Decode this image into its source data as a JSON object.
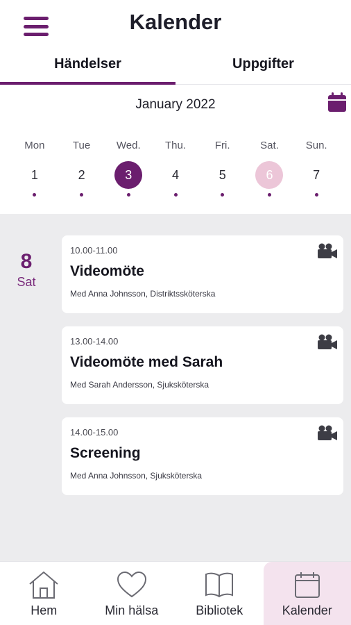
{
  "header": {
    "title": "Kalender",
    "menu_icon": "hamburger-icon"
  },
  "tabs": [
    {
      "label": "Händelser",
      "active": true
    },
    {
      "label": "Uppgifter",
      "active": false
    }
  ],
  "calendar": {
    "month_label": "January 2022",
    "picker_icon": "calendar-icon",
    "accent_color": "#6b1e6e",
    "today_color": "#ecc6d8",
    "days": [
      {
        "name": "Mon",
        "num": "1"
      },
      {
        "name": "Tue",
        "num": "2"
      },
      {
        "name": "Wed.",
        "num": "3",
        "selected": true
      },
      {
        "name": "Thu.",
        "num": "4"
      },
      {
        "name": "Fri.",
        "num": "5"
      },
      {
        "name": "Sat.",
        "num": "6",
        "today": true
      },
      {
        "name": "Sun.",
        "num": "7"
      }
    ]
  },
  "agenda": {
    "date_num": "8",
    "date_dow": "Sat",
    "events": [
      {
        "time": "10.00-11.00",
        "title": "Videomöte",
        "with": "Med Anna Johnsson, Distriktssköterska",
        "icon": "video-camera-icon"
      },
      {
        "time": "13.00-14.00",
        "title": "Videomöte med Sarah",
        "with": "Med Sarah Andersson, Sjuksköterska",
        "icon": "video-camera-icon"
      },
      {
        "time": "14.00-15.00",
        "title": "Screening",
        "with": "Med Anna Johnsson, Sjuksköterska",
        "icon": "video-camera-icon"
      }
    ]
  },
  "bottom_nav": [
    {
      "label": "Hem",
      "icon": "home-icon"
    },
    {
      "label": "Min hälsa",
      "icon": "heart-icon"
    },
    {
      "label": "Bibliotek",
      "icon": "book-icon"
    },
    {
      "label": "Kalender",
      "icon": "calendar-icon",
      "active": true
    }
  ]
}
